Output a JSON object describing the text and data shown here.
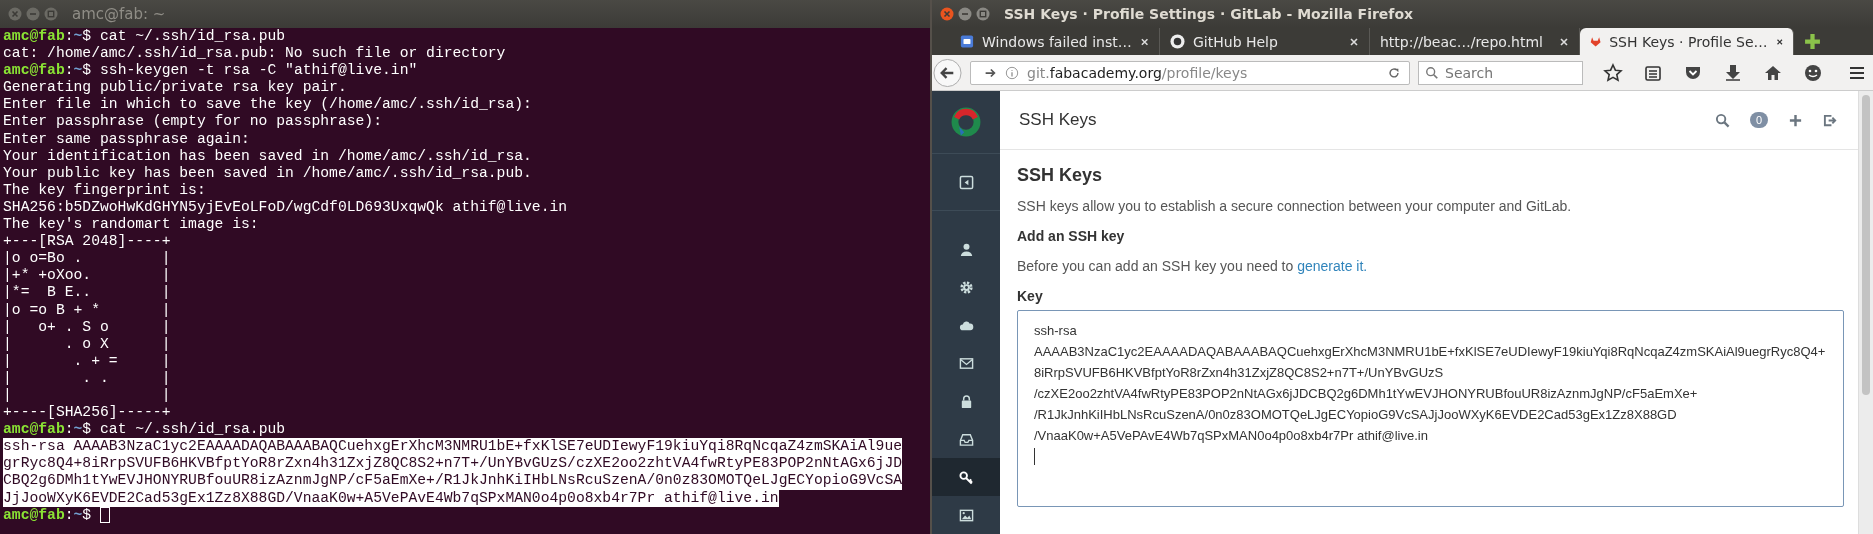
{
  "terminal": {
    "title": "amc@fab: ~",
    "lines": [
      {
        "kind": "prompt",
        "user": "amc@fab",
        "sep": ":",
        "path": "~",
        "symbol": "$",
        "command": "cat ~/.ssh/id_rsa.pub",
        "cursor": false
      },
      {
        "kind": "output",
        "text": "cat: /home/amc/.ssh/id_rsa.pub: No such file or directory"
      },
      {
        "kind": "prompt",
        "user": "amc@fab",
        "sep": ":",
        "path": "~",
        "symbol": "$",
        "command": "ssh-keygen -t rsa -C \"athif@live.in\"",
        "cursor": false
      },
      {
        "kind": "output",
        "text": "Generating public/private rsa key pair."
      },
      {
        "kind": "output",
        "text": "Enter file in which to save the key (/home/amc/.ssh/id_rsa):"
      },
      {
        "kind": "output",
        "text": "Enter passphrase (empty for no passphrase):"
      },
      {
        "kind": "output",
        "text": "Enter same passphrase again:"
      },
      {
        "kind": "output",
        "text": "Your identification has been saved in /home/amc/.ssh/id_rsa."
      },
      {
        "kind": "output",
        "text": "Your public key has been saved in /home/amc/.ssh/id_rsa.pub."
      },
      {
        "kind": "output",
        "text": "The key fingerprint is:"
      },
      {
        "kind": "output",
        "text": "SHA256:b5DZwoHwKdGHYN5yjEvEoLFoD/wgCdf0LD693UxqwQk athif@live.in"
      },
      {
        "kind": "output",
        "text": "The key's randomart image is:"
      },
      {
        "kind": "output",
        "text": "+---[RSA 2048]----+"
      },
      {
        "kind": "output",
        "text": "|o o=Bo .         |"
      },
      {
        "kind": "output",
        "text": "|+* +oXoo.        |"
      },
      {
        "kind": "output",
        "text": "|*=  B E..        |"
      },
      {
        "kind": "output",
        "text": "|o =o B + *       |"
      },
      {
        "kind": "output",
        "text": "|   o+ . S o      |"
      },
      {
        "kind": "output",
        "text": "|      . o X      |"
      },
      {
        "kind": "output",
        "text": "|       . + =     |"
      },
      {
        "kind": "output",
        "text": "|        . .      |"
      },
      {
        "kind": "output",
        "text": "|                 |"
      },
      {
        "kind": "output",
        "text": "+----[SHA256]-----+"
      },
      {
        "kind": "prompt",
        "user": "amc@fab",
        "sep": ":",
        "path": "~",
        "symbol": "$",
        "command": "cat ~/.ssh/id_rsa.pub",
        "cursor": false
      },
      {
        "kind": "selected",
        "text": "ssh-rsa AAAAB3NzaC1yc2EAAAADAQABAAABAQCuehxgErXhcM3NMRU1bE+fxKlSE7eUDIewyF19kiuYqi8RqNcqaZ4zmSKAiAl9ue"
      },
      {
        "kind": "selected",
        "text": "grRyc8Q4+8iRrpSVUFB6HKVBfptYoR8rZxn4h31ZxjZ8QC8S2+n7T+/UnYBvGUzS/czXE2oo2zhtVA4fwRtyPE83POP2nNtAGx6jJD"
      },
      {
        "kind": "selected",
        "text": "CBQ2g6DMh1tYwEVJHONYRUBfouUR8izAznmJgNP/cF5aEmXe+/R1JkJnhKiIHbLNsRcuSzenA/0n0z83OMOTQeLJgECYopioG9VcSA"
      },
      {
        "kind": "selected",
        "text": "JjJooWXyK6EVDE2Cad53gEx1Zz8X88GD/VnaaK0w+A5VePAvE4Wb7qSPxMAN0o4p0o8xb4r7Pr athif@live.in"
      },
      {
        "kind": "prompt",
        "user": "amc@fab",
        "sep": ":",
        "path": "~",
        "symbol": "$",
        "cursor": true
      }
    ]
  },
  "browser": {
    "title": "SSH Keys · Profile Settings · GitLab - Mozilla Firefox",
    "tabs": [
      {
        "label": "Windows failed inst…",
        "selected": false
      },
      {
        "label": "GitHub Help",
        "selected": false
      },
      {
        "label": "http://beac…/repo.html",
        "selected": false
      },
      {
        "label": "SSH Keys · Profile Se…",
        "selected": true
      }
    ],
    "url": {
      "prefix": "git.",
      "domain": "fabacademy.org",
      "path": "/profile/keys"
    },
    "search": {
      "placeholder": "Search"
    }
  },
  "gitlab": {
    "sidebar": {
      "items": [
        {
          "selected": false
        },
        {
          "selected": false
        },
        {
          "selected": false
        },
        {
          "selected": false
        },
        {
          "selected": false
        },
        {
          "selected": false
        },
        {
          "selected": false
        },
        {
          "selected": true
        },
        {
          "selected": false
        }
      ]
    },
    "header": {
      "title": "SSH Keys",
      "badge": "0"
    },
    "heading": "SSH Keys",
    "intro": "SSH keys allow you to establish a secure connection between your computer and GitLab.",
    "add_heading": "Add an SSH key",
    "hint": {
      "text": "Before you can add an SSH key you need to",
      "link": "generate it."
    },
    "key_label": "Key",
    "key_value": [
      "ssh-rsa",
      "AAAAB3NzaC1yc2EAAAADAQABAAABAQCuehxgErXhcM3NMRU1bE+fxKlSE7eUDIewyF19kiuYqi8RqNcqaZ4zmSKAiAl9uegrRyc8Q4+",
      "8iRrpSVUFB6HKVBfptYoR8rZxn4h31ZxjZ8QC8S2+n7T+/UnYBvGUzS",
      "/czXE2oo2zhtVA4fwRtyPE83POP2nNtAGx6jJDCBQ2g6DMh1tYwEVJHONYRUBfouUR8izAznmJgNP/cF5aEmXe+",
      "/R1JkJnhKiIHbLNsRcuSzenA/0n0z83OMOTQeLJgECYopioG9VcSAJjJooWXyK6EVDE2Cad53gEx1Zz8X88GD",
      "/VnaaK0w+A5VePAvE4Wb7qSPxMAN0o4p0o8xb4r7Pr athif@live.in"
    ]
  }
}
